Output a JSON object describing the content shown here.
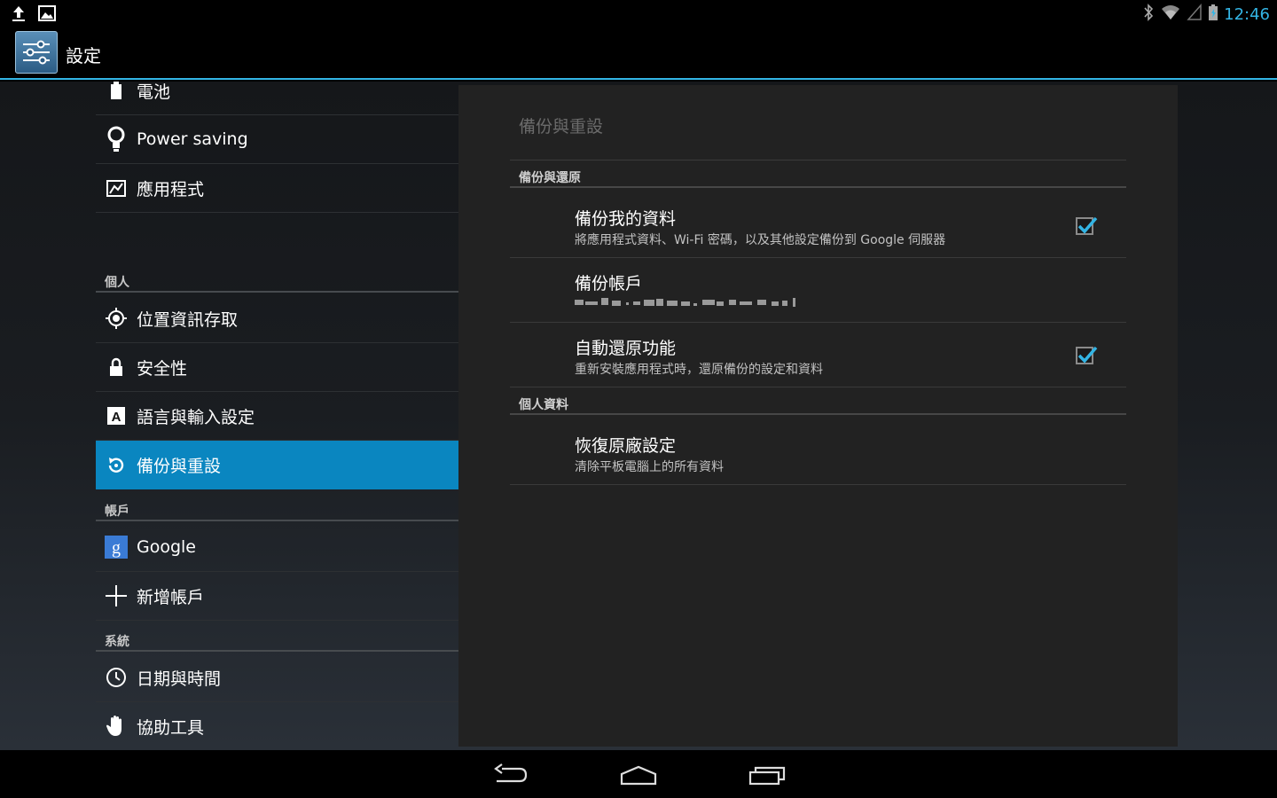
{
  "status": {
    "time": "12:46"
  },
  "app": {
    "title": "設定"
  },
  "sidebar": {
    "items": [
      {
        "label": "電池"
      },
      {
        "label": "Power saving"
      },
      {
        "label": "應用程式"
      },
      {
        "label": "位置資訊存取"
      },
      {
        "label": "安全性"
      },
      {
        "label": "語言與輸入設定"
      },
      {
        "label": "備份與重設"
      },
      {
        "label": "Google"
      },
      {
        "label": "新增帳戶"
      },
      {
        "label": "日期與時間"
      },
      {
        "label": "協助工具"
      }
    ],
    "sections": [
      {
        "label": "個人"
      },
      {
        "label": "帳戶"
      },
      {
        "label": "系統"
      }
    ]
  },
  "panel": {
    "title": "備份與重設",
    "sections": [
      {
        "label": "備份與還原"
      },
      {
        "label": "個人資料"
      }
    ],
    "prefs": [
      {
        "title": "備份我的資料",
        "summary": "將應用程式資料、Wi-Fi 密碼，以及其他設定備份到 Google 伺服器",
        "checked": true
      },
      {
        "title": "備份帳戶",
        "summary": ""
      },
      {
        "title": "自動還原功能",
        "summary": "重新安裝應用程式時，還原備份的設定和資料",
        "checked": true
      },
      {
        "title": "恢復原廠設定",
        "summary": "清除平板電腦上的所有資料"
      }
    ]
  },
  "colors": {
    "accent": "#33b5e5",
    "selected": "#0a86c0"
  }
}
